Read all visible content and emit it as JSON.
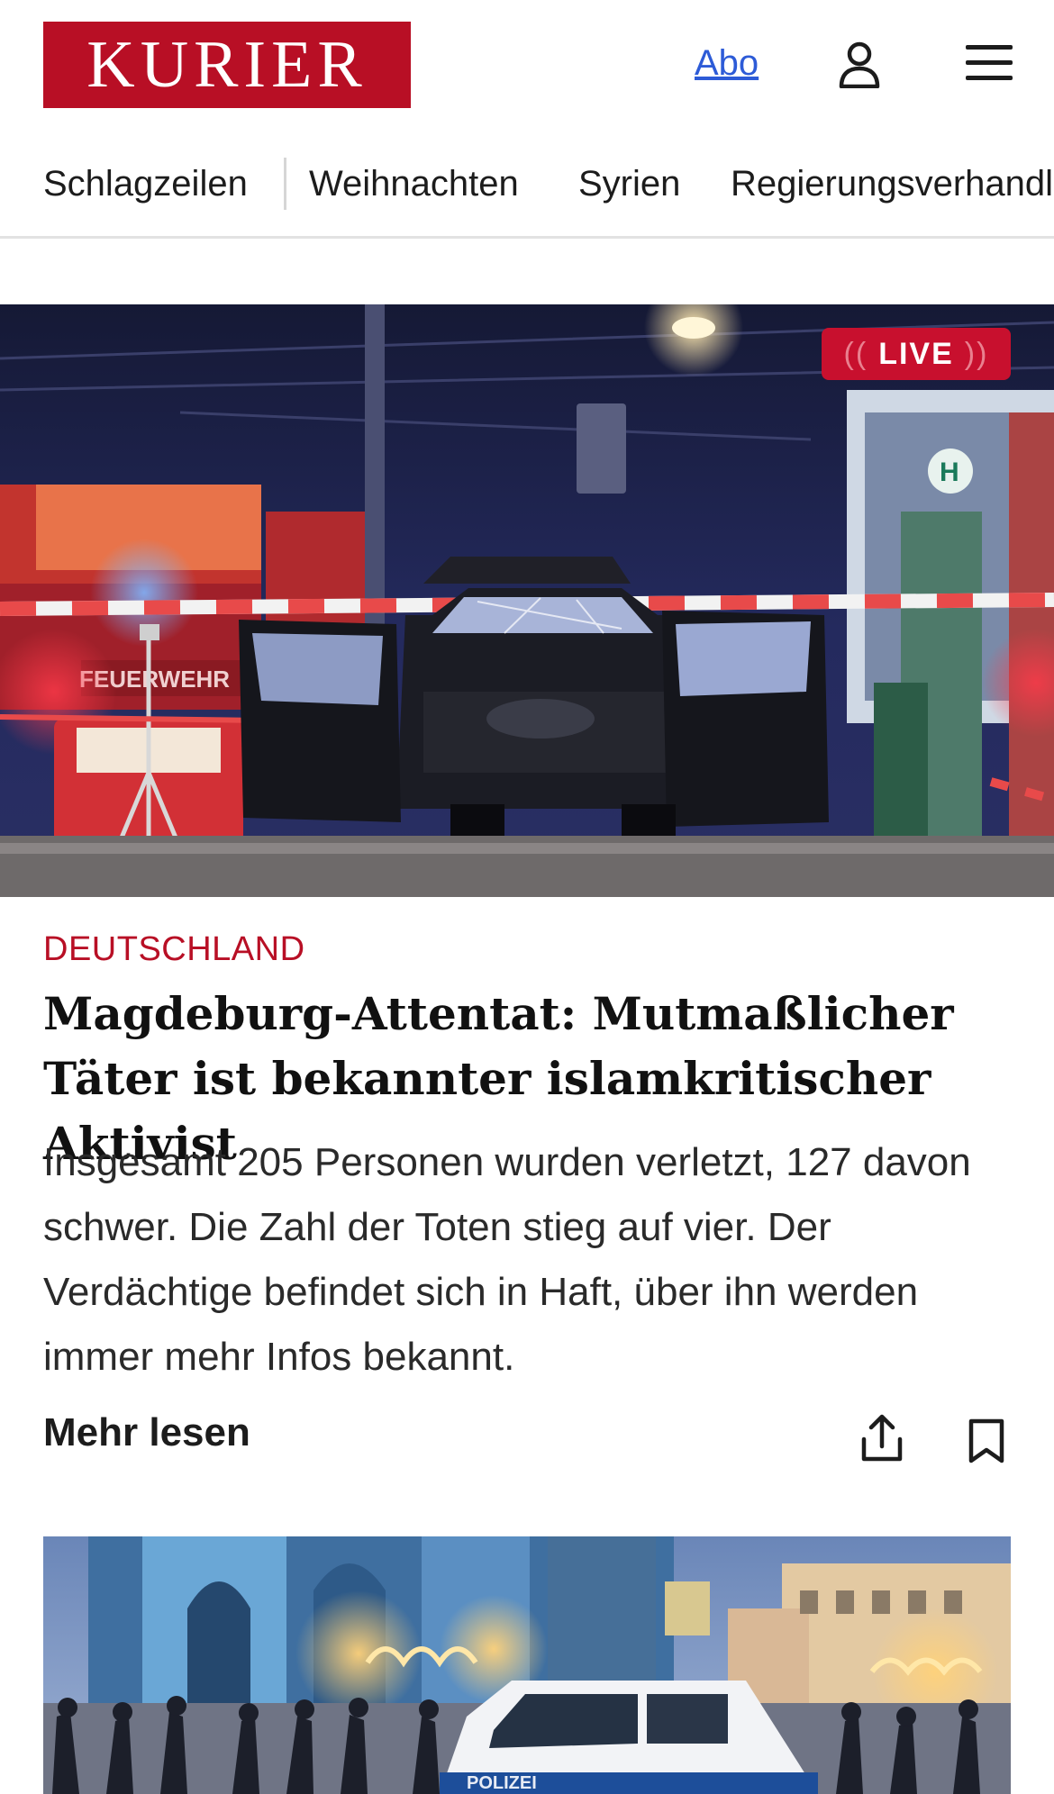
{
  "header": {
    "logo_text": "KURIER",
    "abo_label": "Abo"
  },
  "nav": {
    "items": [
      "Schlagzeilen",
      "Weihnachten",
      "Syrien",
      "Regierungsverhandlungen"
    ]
  },
  "hero": {
    "badge_label": "LIVE",
    "police_tape_text": "FEUERWEHR"
  },
  "article": {
    "kicker": "DEUTSCHLAND",
    "headline": "Magdeburg-Attentat: Mutmaßlicher Täter ist bekannter islamkritischer Aktivist",
    "teaser": "Insgesamt 205 Personen wurden verletzt, 127 davon schwer. Die Zahl der Toten stieg auf vier. Der Verdächtige befindet sich in Haft, über ihn werden immer mehr Infos bekannt.",
    "more_label": "Mehr lesen"
  },
  "second_image": {
    "van_text": "POLIZEI"
  },
  "colors": {
    "brand": "#b80f25",
    "link": "#2d5bd7",
    "live": "#c8102e"
  },
  "icons": [
    "user-icon",
    "menu-icon",
    "share-icon",
    "bookmark-icon"
  ]
}
